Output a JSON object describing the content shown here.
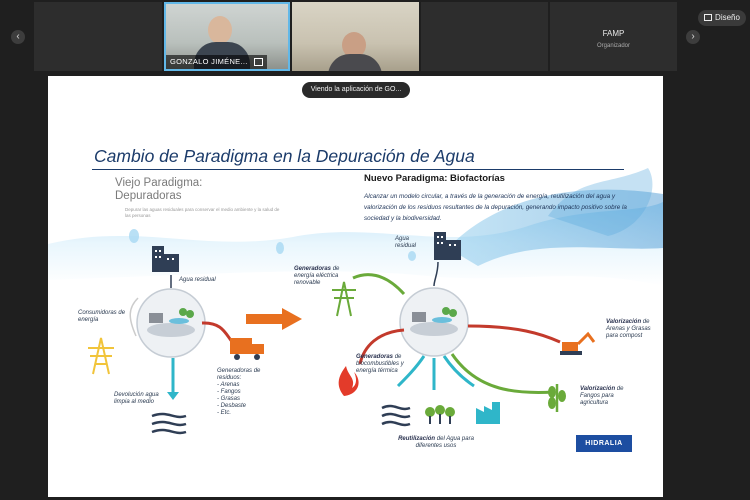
{
  "meeting": {
    "participants": [
      {
        "name": "GONZALO JIMÉNE...",
        "icon": "pin-icon"
      },
      {
        "name": ""
      }
    ],
    "organizer_tile": {
      "name": "FAMP",
      "role": "Organizador"
    },
    "hide_button": "Diseño",
    "viewing_label": "Viendo la aplicación de GO...",
    "nav_prev_icon": "chevron-left-icon",
    "nav_next_icon": "chevron-right-icon"
  },
  "slide": {
    "title": "Cambio de Paradigma en la Depuración de Agua",
    "old_paradigm": {
      "heading": "Viejo Paradigma: Depuradoras",
      "desc": "Depurar las aguas residuales para conservar el medio ambiente y la salud de las personas"
    },
    "new_paradigm": {
      "heading": "Nuevo Paradigma: Biofactorías",
      "desc": "Alcanzar un modelo circular, a través de la generación de energía, reutilización del agua y valorización de los residuos resultantes de la depuración, generando impacto positivo sobre la sociedad y la biodiversidad."
    },
    "labels": {
      "agua_residual_left": "Agua residual",
      "consumidoras": "Consumidoras de energía",
      "devolucion": "Devolución agua limpia al medio",
      "generadoras_residuos_title": "Generadoras de residuos:",
      "residuos": [
        "Arenas",
        "Fangos",
        "Grasas",
        "Desbaste",
        "Etc."
      ],
      "agua_residual_right": "Agua residual",
      "gen_electrica_bold": "Generadoras",
      "gen_electrica_rest": "de energía eléctrica renovable",
      "gen_bio_bold": "Generadoras",
      "gen_bio_rest": "de biocombustibles y energía térmica",
      "val_arenas_bold": "Valorización",
      "val_arenas_rest": "de Arenas y Grasas para compost",
      "val_fangos_bold": "Valorización",
      "val_fangos_rest": "de Fangos para agricultura",
      "reutil_bold": "Reutilización",
      "reutil_rest": "del Agua para diferentes usos"
    },
    "logo": "HIDRALIA",
    "colors": {
      "title": "#1b3b6a",
      "accent_orange": "#e8701f",
      "arrow_red": "#c33a2c",
      "arrow_green": "#6aaa3a",
      "arrow_teal": "#2fb6c9",
      "icon_yellow": "#f1c43a",
      "icon_dark": "#2f3e55"
    }
  }
}
